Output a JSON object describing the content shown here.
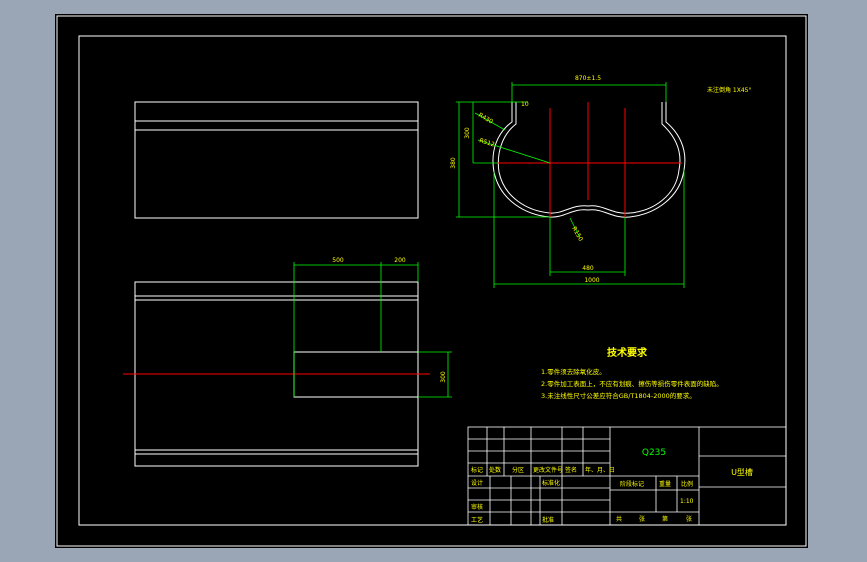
{
  "drawing": {
    "dimensions": {
      "top_width": "870±1.5",
      "top_offset": "10",
      "left_outer": "380",
      "left_inner": "300",
      "radius_a": "R430",
      "radius_b": "R512",
      "radius_c": "R150",
      "bottom_inner": "480",
      "bottom_outer": "1000",
      "side_a": "500",
      "side_b": "200",
      "side_c": "300"
    },
    "roughness_note": "未注倒角 1X45°"
  },
  "tech_requirements": {
    "title": "技术要求",
    "items": [
      "1.零件须去除氧化皮。",
      "2.零件加工表面上，不应有划痕、擦伤等损伤零件表面的缺陷。",
      "3.未注线性尺寸公差应符合GB/T1804-2000的要求。"
    ]
  },
  "title_block": {
    "material": "Q235",
    "part_name": "U型槽",
    "header_labels": [
      "标记",
      "处数",
      "分区",
      "更改文件号",
      "签名",
      "年、月、日"
    ],
    "row_design": "设计",
    "row_standard": "标准化",
    "row_review": "审核",
    "row_process": "工艺",
    "row_approve": "批准",
    "stage_label": "阶段标记",
    "weight_label": "重量",
    "scale_label": "比例",
    "scale_value": "1:10",
    "sheet_total": "共",
    "sheet_total_unit": "张",
    "sheet_no": "第",
    "sheet_no_unit": "张"
  },
  "colors": {
    "background": "#000000",
    "frame": "#ffffff",
    "dimension": "#00ff00",
    "centerline": "#ff0000",
    "text": "#ffff00"
  }
}
